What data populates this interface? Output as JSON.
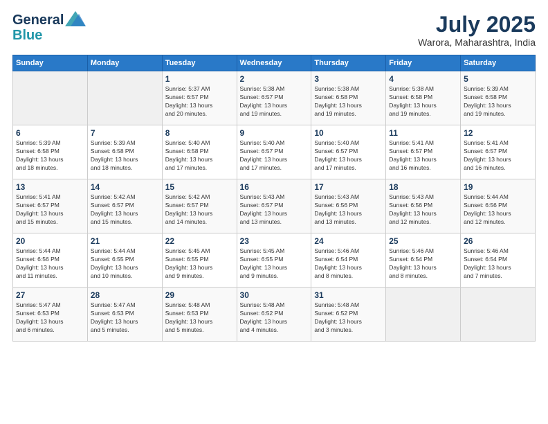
{
  "header": {
    "logo_line1": "General",
    "logo_line2": "Blue",
    "month_year": "July 2025",
    "location": "Warora, Maharashtra, India"
  },
  "days_of_week": [
    "Sunday",
    "Monday",
    "Tuesday",
    "Wednesday",
    "Thursday",
    "Friday",
    "Saturday"
  ],
  "weeks": [
    [
      {
        "day": "",
        "info": ""
      },
      {
        "day": "",
        "info": ""
      },
      {
        "day": "1",
        "info": "Sunrise: 5:37 AM\nSunset: 6:57 PM\nDaylight: 13 hours\nand 20 minutes."
      },
      {
        "day": "2",
        "info": "Sunrise: 5:38 AM\nSunset: 6:57 PM\nDaylight: 13 hours\nand 19 minutes."
      },
      {
        "day": "3",
        "info": "Sunrise: 5:38 AM\nSunset: 6:58 PM\nDaylight: 13 hours\nand 19 minutes."
      },
      {
        "day": "4",
        "info": "Sunrise: 5:38 AM\nSunset: 6:58 PM\nDaylight: 13 hours\nand 19 minutes."
      },
      {
        "day": "5",
        "info": "Sunrise: 5:39 AM\nSunset: 6:58 PM\nDaylight: 13 hours\nand 19 minutes."
      }
    ],
    [
      {
        "day": "6",
        "info": "Sunrise: 5:39 AM\nSunset: 6:58 PM\nDaylight: 13 hours\nand 18 minutes."
      },
      {
        "day": "7",
        "info": "Sunrise: 5:39 AM\nSunset: 6:58 PM\nDaylight: 13 hours\nand 18 minutes."
      },
      {
        "day": "8",
        "info": "Sunrise: 5:40 AM\nSunset: 6:58 PM\nDaylight: 13 hours\nand 17 minutes."
      },
      {
        "day": "9",
        "info": "Sunrise: 5:40 AM\nSunset: 6:57 PM\nDaylight: 13 hours\nand 17 minutes."
      },
      {
        "day": "10",
        "info": "Sunrise: 5:40 AM\nSunset: 6:57 PM\nDaylight: 13 hours\nand 17 minutes."
      },
      {
        "day": "11",
        "info": "Sunrise: 5:41 AM\nSunset: 6:57 PM\nDaylight: 13 hours\nand 16 minutes."
      },
      {
        "day": "12",
        "info": "Sunrise: 5:41 AM\nSunset: 6:57 PM\nDaylight: 13 hours\nand 16 minutes."
      }
    ],
    [
      {
        "day": "13",
        "info": "Sunrise: 5:41 AM\nSunset: 6:57 PM\nDaylight: 13 hours\nand 15 minutes."
      },
      {
        "day": "14",
        "info": "Sunrise: 5:42 AM\nSunset: 6:57 PM\nDaylight: 13 hours\nand 15 minutes."
      },
      {
        "day": "15",
        "info": "Sunrise: 5:42 AM\nSunset: 6:57 PM\nDaylight: 13 hours\nand 14 minutes."
      },
      {
        "day": "16",
        "info": "Sunrise: 5:43 AM\nSunset: 6:57 PM\nDaylight: 13 hours\nand 13 minutes."
      },
      {
        "day": "17",
        "info": "Sunrise: 5:43 AM\nSunset: 6:56 PM\nDaylight: 13 hours\nand 13 minutes."
      },
      {
        "day": "18",
        "info": "Sunrise: 5:43 AM\nSunset: 6:56 PM\nDaylight: 13 hours\nand 12 minutes."
      },
      {
        "day": "19",
        "info": "Sunrise: 5:44 AM\nSunset: 6:56 PM\nDaylight: 13 hours\nand 12 minutes."
      }
    ],
    [
      {
        "day": "20",
        "info": "Sunrise: 5:44 AM\nSunset: 6:56 PM\nDaylight: 13 hours\nand 11 minutes."
      },
      {
        "day": "21",
        "info": "Sunrise: 5:44 AM\nSunset: 6:55 PM\nDaylight: 13 hours\nand 10 minutes."
      },
      {
        "day": "22",
        "info": "Sunrise: 5:45 AM\nSunset: 6:55 PM\nDaylight: 13 hours\nand 9 minutes."
      },
      {
        "day": "23",
        "info": "Sunrise: 5:45 AM\nSunset: 6:55 PM\nDaylight: 13 hours\nand 9 minutes."
      },
      {
        "day": "24",
        "info": "Sunrise: 5:46 AM\nSunset: 6:54 PM\nDaylight: 13 hours\nand 8 minutes."
      },
      {
        "day": "25",
        "info": "Sunrise: 5:46 AM\nSunset: 6:54 PM\nDaylight: 13 hours\nand 8 minutes."
      },
      {
        "day": "26",
        "info": "Sunrise: 5:46 AM\nSunset: 6:54 PM\nDaylight: 13 hours\nand 7 minutes."
      }
    ],
    [
      {
        "day": "27",
        "info": "Sunrise: 5:47 AM\nSunset: 6:53 PM\nDaylight: 13 hours\nand 6 minutes."
      },
      {
        "day": "28",
        "info": "Sunrise: 5:47 AM\nSunset: 6:53 PM\nDaylight: 13 hours\nand 5 minutes."
      },
      {
        "day": "29",
        "info": "Sunrise: 5:48 AM\nSunset: 6:53 PM\nDaylight: 13 hours\nand 5 minutes."
      },
      {
        "day": "30",
        "info": "Sunrise: 5:48 AM\nSunset: 6:52 PM\nDaylight: 13 hours\nand 4 minutes."
      },
      {
        "day": "31",
        "info": "Sunrise: 5:48 AM\nSunset: 6:52 PM\nDaylight: 13 hours\nand 3 minutes."
      },
      {
        "day": "",
        "info": ""
      },
      {
        "day": "",
        "info": ""
      }
    ]
  ]
}
